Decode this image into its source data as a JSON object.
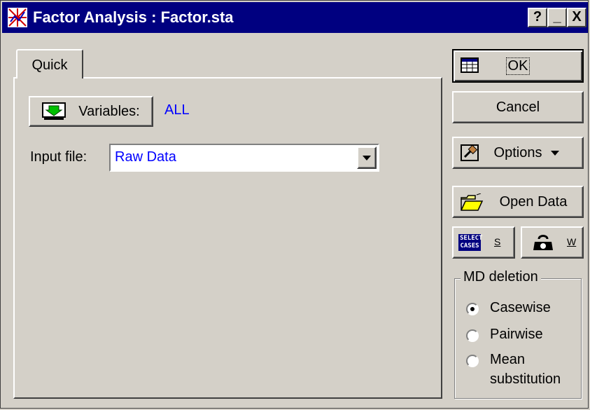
{
  "window": {
    "title": "Factor Analysis : Factor.sta"
  },
  "titlebar": {
    "help_label": "?",
    "minimize_label": "_",
    "close_label": "X"
  },
  "tabs": [
    {
      "label": "Quick"
    }
  ],
  "quick": {
    "variables_button_label": "Variables:",
    "variables_value": "ALL",
    "input_file_label": "Input file:",
    "input_file_value": "Raw Data"
  },
  "buttons": {
    "ok_label": "OK",
    "cancel_label": "Cancel",
    "options_label": "Options",
    "open_data_label": "Open Data",
    "select_cases_line1": "SELECT",
    "select_cases_line2": "CASES",
    "select_cases_short": "S",
    "weight_short": "W"
  },
  "md_deletion": {
    "title": "MD deletion",
    "options": [
      {
        "label": "Casewise",
        "selected": true
      },
      {
        "label": "Pairwise",
        "selected": false
      },
      {
        "label": "Mean",
        "selected": false
      }
    ],
    "mean_second_line": "substitution"
  },
  "colors": {
    "titlebar": "#000080",
    "face": "#d4d0c8",
    "value_text": "#0000ff"
  },
  "icons": [
    "statistica-app-icon",
    "variables-icon",
    "ok-sheet-icon",
    "options-gavel-icon",
    "open-folder-icon",
    "select-cases-icon",
    "weight-icon",
    "dropdown-arrow-icon"
  ]
}
